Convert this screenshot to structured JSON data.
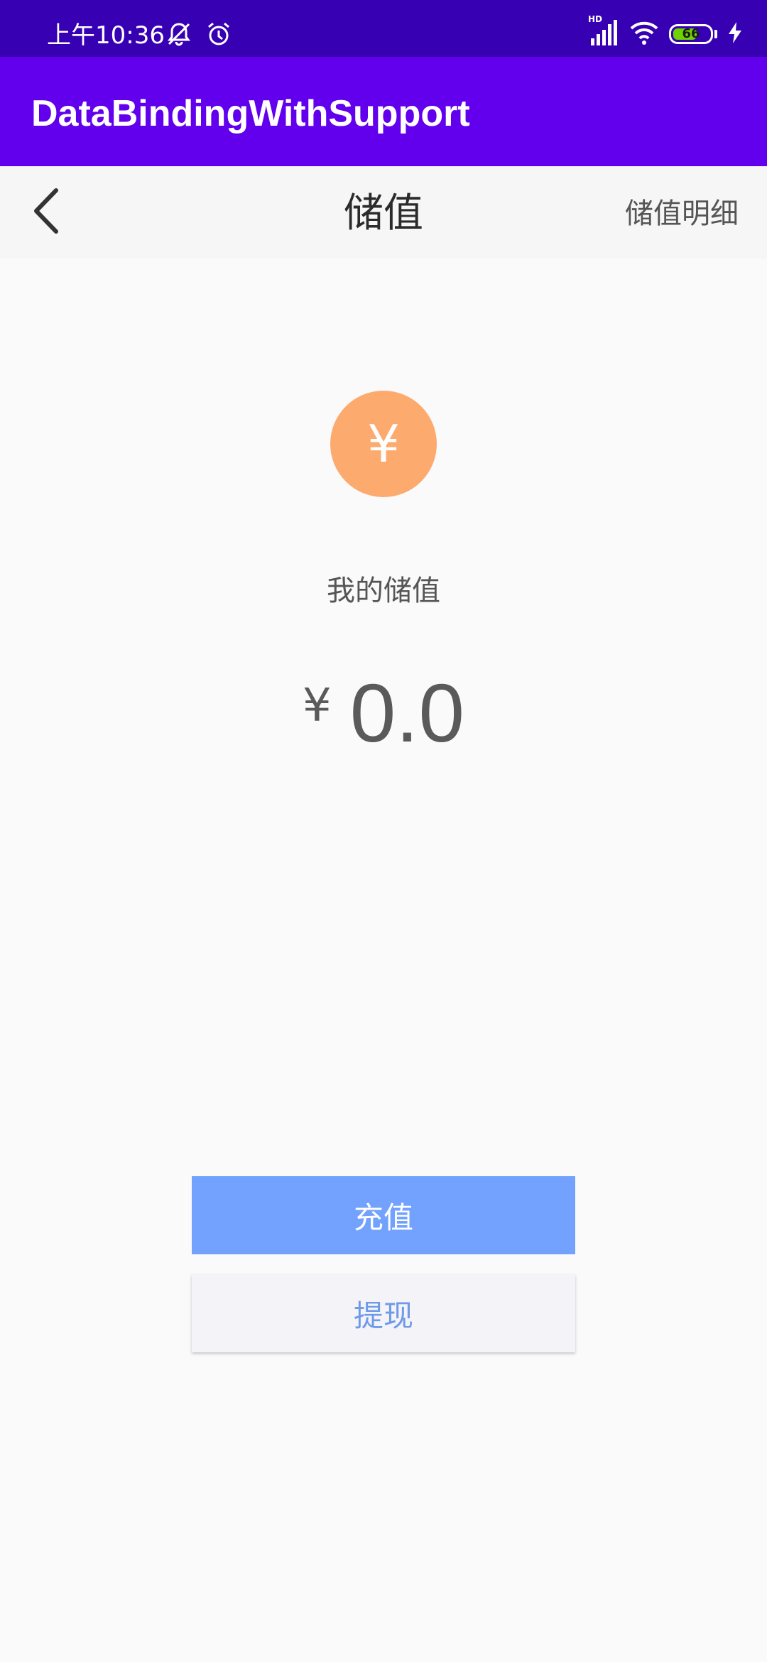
{
  "status_bar": {
    "time": "上午10:36",
    "network_badge": "HD",
    "battery_level": "66",
    "battery_fraction": 0.66,
    "icons": [
      "bell-muted-icon",
      "alarm-icon",
      "signal-icon",
      "wifi-icon",
      "battery-icon",
      "charging-icon"
    ]
  },
  "app_bar": {
    "title": "DataBindingWithSupport"
  },
  "nav": {
    "back_icon": "chevron-left-icon",
    "title": "储值",
    "detail_link": "储值明细"
  },
  "balance": {
    "icon_symbol": "¥",
    "label": "我的储值",
    "currency": "¥",
    "amount": "0.0"
  },
  "actions": {
    "recharge_label": "充值",
    "withdraw_label": "提现"
  },
  "colors": {
    "status_bar": "#3700b3",
    "app_bar": "#6200ee",
    "coin": "#fdaa6f",
    "primary_button": "#72a2fe",
    "secondary_button_text": "#6f9ae8",
    "battery_fill": "#6dd400"
  }
}
